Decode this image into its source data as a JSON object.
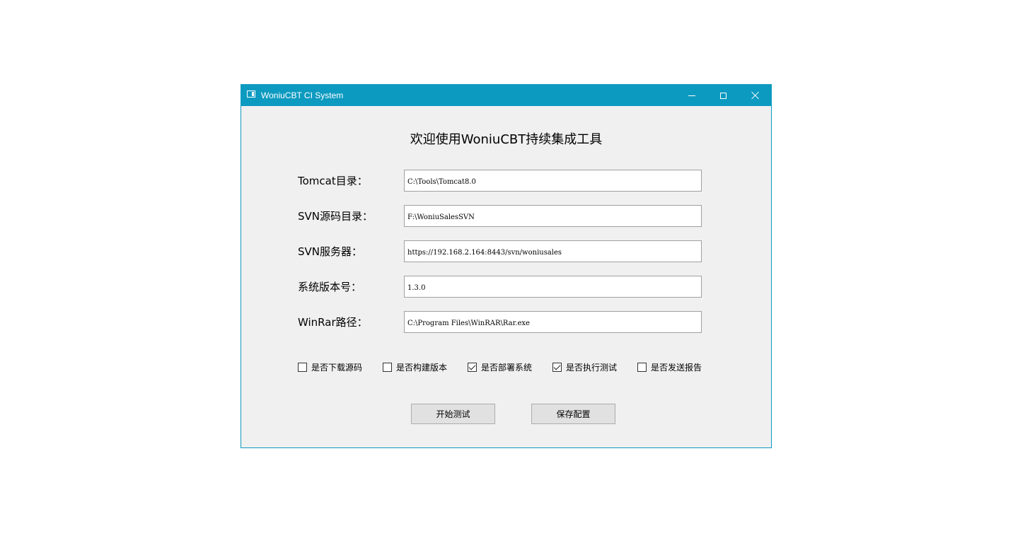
{
  "window": {
    "title": "WoniuCBT CI System"
  },
  "heading": "欢迎使用WoniuCBT持续集成工具",
  "fields": [
    {
      "label": "Tomcat目录：",
      "value": "C:\\Tools\\Tomcat8.0"
    },
    {
      "label": "SVN源码目录：",
      "value": "F:\\WoniuSalesSVN"
    },
    {
      "label": "SVN服务器：",
      "value": "https://192.168.2.164:8443/svn/woniusales"
    },
    {
      "label": "系统版本号：",
      "value": "1.3.0"
    },
    {
      "label": "WinRar路径：",
      "value": "C:\\Program Files\\WinRAR\\Rar.exe"
    }
  ],
  "options": [
    {
      "label": "是否下载源码",
      "checked": false
    },
    {
      "label": "是否构建版本",
      "checked": false
    },
    {
      "label": "是否部署系统",
      "checked": true
    },
    {
      "label": "是否执行测试",
      "checked": true
    },
    {
      "label": "是否发送报告",
      "checked": false
    }
  ],
  "buttons": {
    "start_label": "开始测试",
    "save_label": "保存配置"
  },
  "colors": {
    "titlebar": "#0d9ac0",
    "window_bg": "#f0f0f0"
  }
}
